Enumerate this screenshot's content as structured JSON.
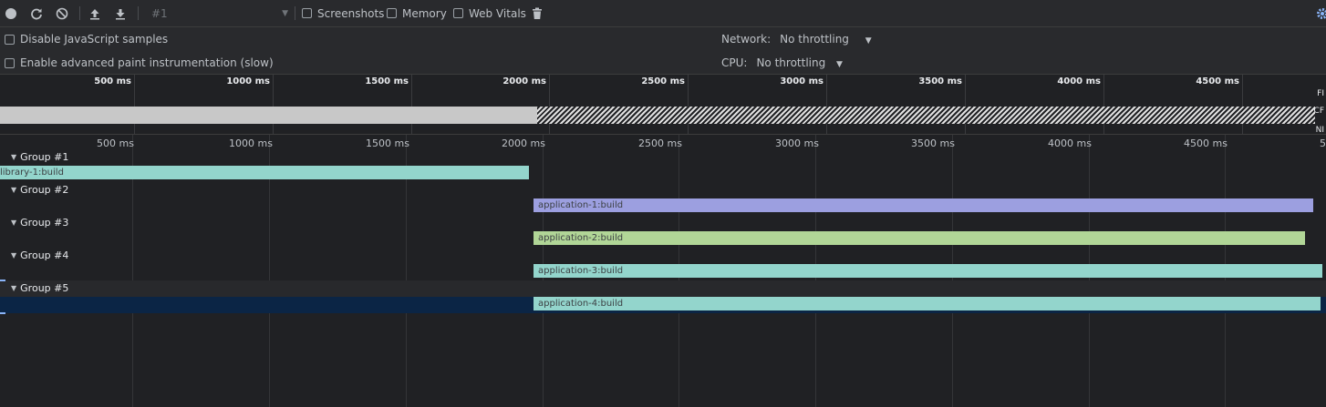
{
  "toolbar": {
    "profile_select": "#1",
    "screenshots_label": "Screenshots",
    "memory_label": "Memory",
    "webvitals_label": "Web Vitals"
  },
  "settings": {
    "disable_js_samples": "Disable JavaScript samples",
    "advanced_paint": "Enable advanced paint instrumentation (slow)",
    "network_label": "Network:",
    "network_value": "No throttling",
    "cpu_label": "CPU:",
    "cpu_value": "No throttling"
  },
  "overview": {
    "ticks": [
      "500 ms",
      "1000 ms",
      "1500 ms",
      "2000 ms",
      "2500 ms",
      "3000 ms",
      "3500 ms",
      "4000 ms",
      "4500 ms"
    ],
    "side_labels": [
      "FI",
      "CF",
      "NI"
    ]
  },
  "ruler": {
    "ticks": [
      "500 ms",
      "1000 ms",
      "1500 ms",
      "2000 ms",
      "2500 ms",
      "3000 ms",
      "3500 ms",
      "4000 ms",
      "4500 ms"
    ],
    "edge_label": "5"
  },
  "groups": [
    {
      "label": "Group #1",
      "task": "library-1:build",
      "color": "#93d5cc"
    },
    {
      "label": "Group #2",
      "task": "application-1:build",
      "color": "#9c9fe0"
    },
    {
      "label": "Group #3",
      "task": "application-2:build",
      "color": "#b1d697"
    },
    {
      "label": "Group #4",
      "task": "application-3:build",
      "color": "#93d5cc"
    },
    {
      "label": "Group #5",
      "task": "application-4:build",
      "color": "#93d5cc"
    }
  ],
  "colors": {
    "background": "#202124",
    "toolbar": "#292a2d",
    "selection_row": "#0b2545",
    "accent": "#8ab4f8"
  }
}
